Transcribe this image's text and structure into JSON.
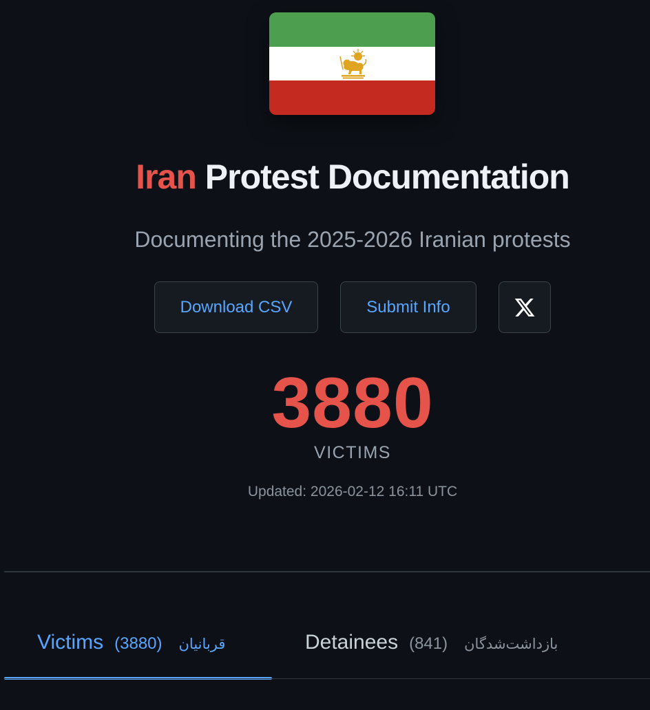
{
  "flag": {
    "icon": "lion-and-sun-flag-icon",
    "colors": {
      "green": "#4e9e4f",
      "white": "#ffffff",
      "red": "#c52a20",
      "emblem": "#e0a520"
    }
  },
  "header": {
    "title_accent": "Iran",
    "title_rest": " Protest Documentation",
    "subtitle": "Documenting the 2025-2026 Iranian protests",
    "accent_color": "#e5534b"
  },
  "actions": {
    "download_csv": "Download CSV",
    "submit_info": "Submit Info",
    "x_icon": "x-logo-icon"
  },
  "stats": {
    "count": "3880",
    "label": "VICTIMS",
    "updated": "Updated: 2026-02-12 16:11 UTC"
  },
  "tabs": [
    {
      "label": "Victims",
      "count": "(3880)",
      "label_fa": "قربانیان",
      "active": true
    },
    {
      "label": "Detainees",
      "count": "(841)",
      "label_fa": "بازداشت‌شدگان",
      "active": false
    }
  ]
}
